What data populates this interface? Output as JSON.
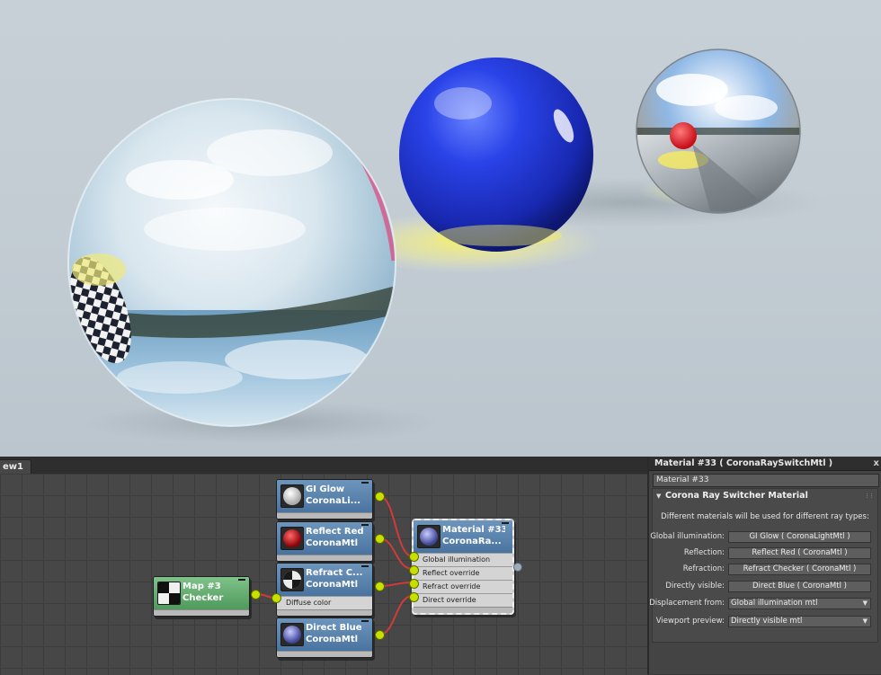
{
  "slate": {
    "tab_label": "ew1",
    "nodes": {
      "gi_glow": {
        "title": "GI Glow",
        "subtitle": "CoronaLi...",
        "icon": "white-sphere-icon"
      },
      "reflect_red": {
        "title": "Reflect Red",
        "subtitle": "CoronaMtl",
        "icon": "red-sphere-icon"
      },
      "refract_checker": {
        "title": "Refract C...",
        "subtitle": "CoronaMtl",
        "icon": "checker-sphere-icon",
        "slot": "Diffuse color"
      },
      "direct_blue": {
        "title": "Direct Blue",
        "subtitle": "CoronaMtl",
        "icon": "blue-sphere-icon"
      },
      "map3": {
        "title": "Map #3",
        "subtitle": "Checker",
        "icon": "checker-icon"
      },
      "material33": {
        "title": "Material #33",
        "subtitle": "CoronaRa...",
        "icon": "blue-sphere-icon",
        "slots": [
          "Global illumination",
          "Reflect override",
          "Refract override",
          "Direct override"
        ]
      }
    },
    "colors": {
      "wire": "#d23a3a",
      "port": "#c8e000",
      "material_header": "#5a84ae",
      "map_header": "#5faa6c"
    }
  },
  "panel": {
    "title": "Material #33  ( CoronaRaySwitchMtl )",
    "close_glyph": "x",
    "name_value": "Material #33",
    "rollout_title": "Corona Ray Switcher Material",
    "description": "Different materials will be used for different ray types:",
    "rows": [
      {
        "label": "Global illumination:",
        "value": "GI Glow  ( CoronaLightMtl )"
      },
      {
        "label": "Reflection:",
        "value": "Reflect Red  ( CoronaMtl )"
      },
      {
        "label": "Refraction:",
        "value": "Refract Checker  ( CoronaMtl )"
      },
      {
        "label": "Directly visible:",
        "value": "Direct Blue  ( CoronaMtl )"
      }
    ],
    "displacement": {
      "label": "Displacement from:",
      "value": "Global illumination mtl"
    },
    "viewport": {
      "label": "Viewport preview:",
      "value": "Directly visible mtl"
    }
  }
}
